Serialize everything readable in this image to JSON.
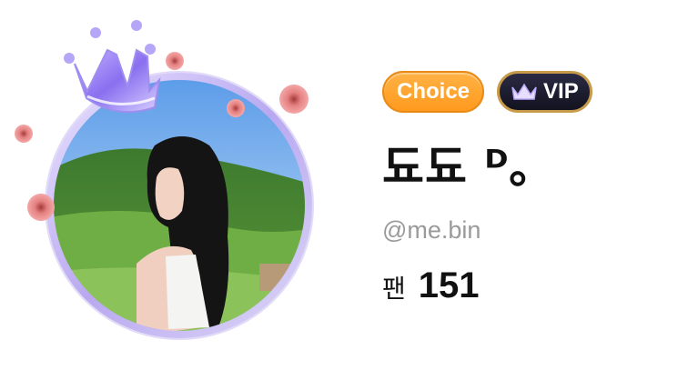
{
  "profile": {
    "badges": {
      "choice_label": "Choice",
      "vip_label": "VIP"
    },
    "display_name": "됴됴 ᴰ｡",
    "handle": "@me.bin",
    "fans_label": "팬",
    "fans_count": "151"
  },
  "icons": {
    "avatar_frame": "crown-avatar-frame",
    "vip_badge_icon": "crown-icon"
  },
  "colors": {
    "choice_badge": "#ff9f28",
    "vip_badge": "#1b1b2e",
    "vip_border": "#c79a4a",
    "handle_text": "#9a9a9a"
  }
}
